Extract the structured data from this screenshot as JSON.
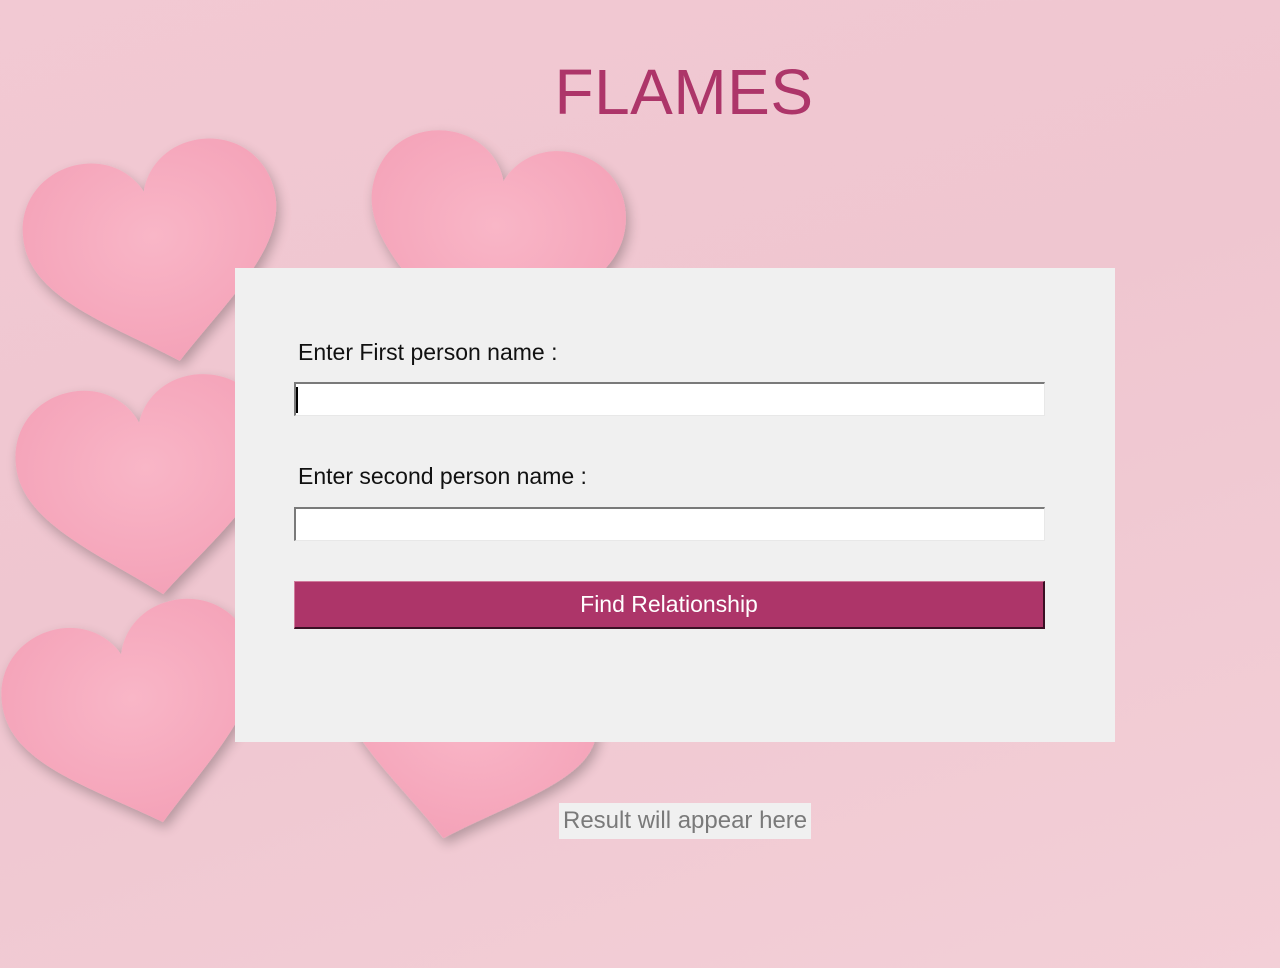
{
  "app": {
    "title": "FLAMES"
  },
  "form": {
    "first_label": "Enter First person name :",
    "first_value": "",
    "second_label": "Enter second person name :",
    "second_value": "",
    "button_label": "Find Relationship"
  },
  "result": {
    "text": "Result will appear here"
  },
  "colors": {
    "accent": "#ad3569",
    "background": "#f0c8d1",
    "panel": "#f0f0f0",
    "heart": "#f7a9be"
  },
  "background": {
    "decoration": "felt-hearts"
  }
}
